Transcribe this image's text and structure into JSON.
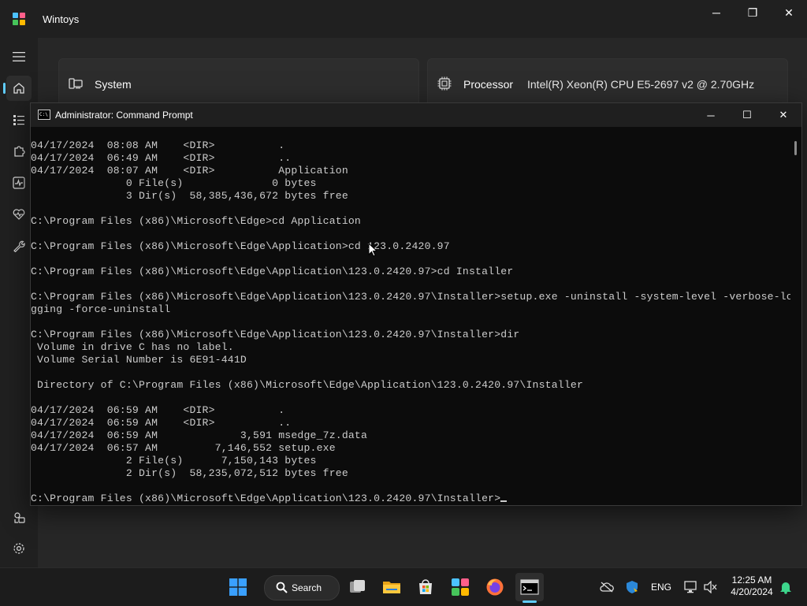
{
  "app": {
    "title": "Wintoys",
    "controls": {
      "minimize": "─",
      "maximize": "❐",
      "close": "✕"
    },
    "nav_icons": [
      "hamburger-menu-icon",
      "home-icon",
      "apps-list-icon",
      "puzzle-icon",
      "performance-icon",
      "health-icon",
      "tools-icon",
      "services-icon",
      "settings-icon"
    ],
    "cards": [
      {
        "title": "System",
        "value": "",
        "icon": "system-icon"
      },
      {
        "title": "Processor",
        "value": "Intel(R) Xeon(R) CPU E5-2697 v2 @ 2.70GHz",
        "icon": "processor-icon"
      }
    ]
  },
  "cmd": {
    "icon_text": "C:\\",
    "title": "Administrator: Command Prompt",
    "controls": {
      "minimize": "─",
      "maximize": "☐",
      "close": "✕"
    },
    "lines": [
      "04/17/2024  08:08 AM    <DIR>          .",
      "04/17/2024  06:49 AM    <DIR>          ..",
      "04/17/2024  08:07 AM    <DIR>          Application",
      "               0 File(s)              0 bytes",
      "               3 Dir(s)  58,385,436,672 bytes free",
      "",
      "C:\\Program Files (x86)\\Microsoft\\Edge>cd Application",
      "",
      "C:\\Program Files (x86)\\Microsoft\\Edge\\Application>cd 123.0.2420.97",
      "",
      "C:\\Program Files (x86)\\Microsoft\\Edge\\Application\\123.0.2420.97>cd Installer",
      "",
      "C:\\Program Files (x86)\\Microsoft\\Edge\\Application\\123.0.2420.97\\Installer>setup.exe -uninstall -system-level -verbose-lo",
      "gging -force-uninstall",
      "",
      "C:\\Program Files (x86)\\Microsoft\\Edge\\Application\\123.0.2420.97\\Installer>dir",
      " Volume in drive C has no label.",
      " Volume Serial Number is 6E91-441D",
      "",
      " Directory of C:\\Program Files (x86)\\Microsoft\\Edge\\Application\\123.0.2420.97\\Installer",
      "",
      "04/17/2024  06:59 AM    <DIR>          .",
      "04/17/2024  06:59 AM    <DIR>          ..",
      "04/17/2024  06:59 AM             3,591 msedge_7z.data",
      "04/17/2024  06:57 AM         7,146,552 setup.exe",
      "               2 File(s)      7,150,143 bytes",
      "               2 Dir(s)  58,235,072,512 bytes free",
      ""
    ],
    "prompt": "C:\\Program Files (x86)\\Microsoft\\Edge\\Application\\123.0.2420.97\\Installer>",
    "input_value": ""
  },
  "taskbar": {
    "search_label": "Search",
    "apps": [
      "start-icon",
      "task-view-icon",
      "file-explorer-icon",
      "microsoft-store-icon",
      "wintoys-icon",
      "firefox-icon",
      "terminal-icon"
    ],
    "tray": {
      "language": "ENG",
      "time": "12:25 AM",
      "date": "4/20/2024"
    }
  }
}
